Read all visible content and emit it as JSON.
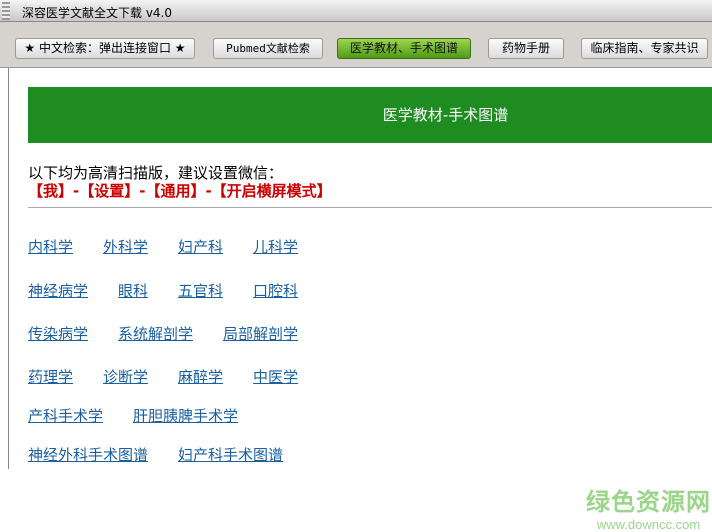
{
  "window": {
    "title": "深容医学文献全文下载 v4.0"
  },
  "toolbar": {
    "buttons": [
      {
        "label": "★ 中文检索：弹出连接窗口 ★"
      },
      {
        "label": "Pubmed文献检索"
      },
      {
        "label": "医学教材、手术图谱",
        "active": true
      },
      {
        "label": "药物手册"
      },
      {
        "label": "临床指南、专家共识"
      }
    ]
  },
  "banner": {
    "title": "医学教材-手术图谱",
    "color": "#1f8c22"
  },
  "note": "以下均为高清扫描版，建议设置微信：",
  "path": "【我】-【设置】-【通用】-【开启横屏模式】",
  "rows": [
    [
      "内科学",
      "外科学",
      "妇产科",
      "儿科学"
    ],
    [
      "神经病学",
      "眼科",
      "五官科",
      "口腔科"
    ],
    [
      "传染病学",
      "系统解剖学",
      "局部解剖学"
    ],
    [
      "药理学",
      "诊断学",
      "麻醉学",
      "中医学"
    ],
    [
      "产科手术学",
      "肝胆胰脾手术学"
    ],
    [
      "神经外科手术图谱",
      "妇产科手术图谱"
    ]
  ],
  "watermark": {
    "name": "绿色资源网",
    "url": "www.downcc.com"
  }
}
